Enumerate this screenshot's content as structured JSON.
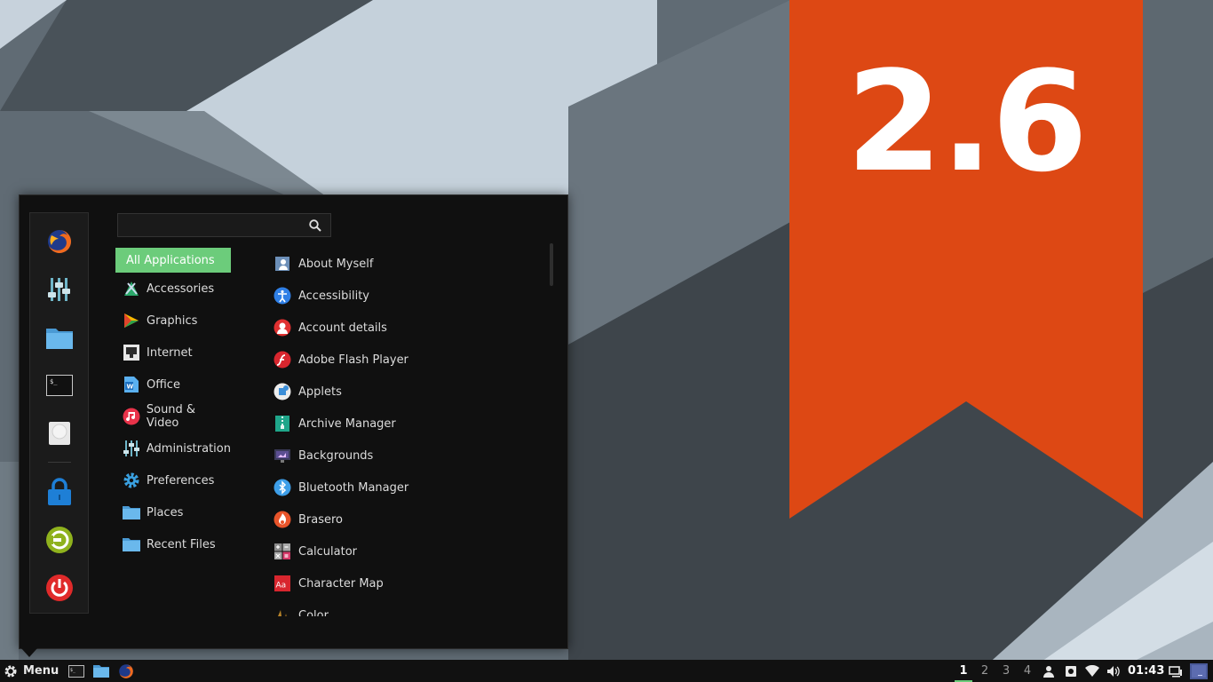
{
  "banner": {
    "version": "2.6"
  },
  "search": {
    "value": "",
    "placeholder": ""
  },
  "favorites": [
    {
      "name": "firefox-icon"
    },
    {
      "name": "settings-icon"
    },
    {
      "name": "folder-icon"
    },
    {
      "name": "terminal-icon"
    },
    {
      "name": "drive-icon"
    },
    {
      "name": "lock-icon"
    },
    {
      "name": "logout-icon"
    },
    {
      "name": "power-icon"
    }
  ],
  "categories": [
    {
      "label": "All Applications",
      "active": true
    },
    {
      "label": "Accessories"
    },
    {
      "label": "Graphics"
    },
    {
      "label": "Internet"
    },
    {
      "label": "Office"
    },
    {
      "label": "Sound & Video"
    },
    {
      "label": "Administration"
    },
    {
      "label": "Preferences"
    },
    {
      "label": "Places"
    },
    {
      "label": "Recent Files"
    }
  ],
  "apps": [
    {
      "label": "About Myself"
    },
    {
      "label": "Accessibility"
    },
    {
      "label": "Account details"
    },
    {
      "label": "Adobe Flash Player"
    },
    {
      "label": "Applets"
    },
    {
      "label": "Archive Manager"
    },
    {
      "label": "Backgrounds"
    },
    {
      "label": "Bluetooth Manager"
    },
    {
      "label": "Brasero"
    },
    {
      "label": "Calculator"
    },
    {
      "label": "Character Map"
    },
    {
      "label": "Color"
    }
  ],
  "panel": {
    "menu_label": "Menu",
    "workspaces": [
      "1",
      "2",
      "3",
      "4"
    ],
    "active_workspace": "1",
    "clock": "01:43"
  },
  "colors": {
    "accent": "#6ccc7b",
    "banner": "#dd4814",
    "menu_bg": "#101010",
    "panel_bg": "#111111"
  }
}
